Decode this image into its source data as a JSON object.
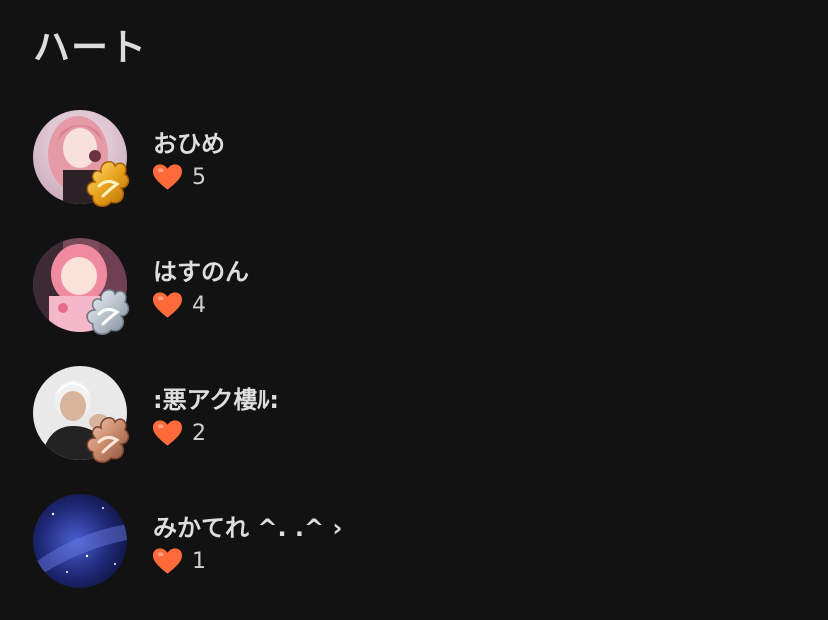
{
  "header": {
    "title": "ハート"
  },
  "users": [
    {
      "name": "おひめ",
      "hearts": "5",
      "avatar": "pink-hair-girl-avatar",
      "badge": "gold"
    },
    {
      "name": "はすのん",
      "hearts": "4",
      "avatar": "pink-kimono-girl-avatar",
      "badge": "silver"
    },
    {
      "name": ":悪アク樓ﾙ:",
      "hearts": "2",
      "avatar": "white-hair-man-avatar",
      "badge": "bronze"
    },
    {
      "name": "みかてれ ^. .^ ›",
      "hearts": "1",
      "avatar": "night-sky-avatar",
      "badge": "none"
    }
  ],
  "colors": {
    "background": "#121212",
    "heart": "#ff6a3a",
    "gold_badge": "#e8a21c",
    "silver_badge": "#b9c2cc",
    "bronze_badge": "#c98a6c"
  }
}
